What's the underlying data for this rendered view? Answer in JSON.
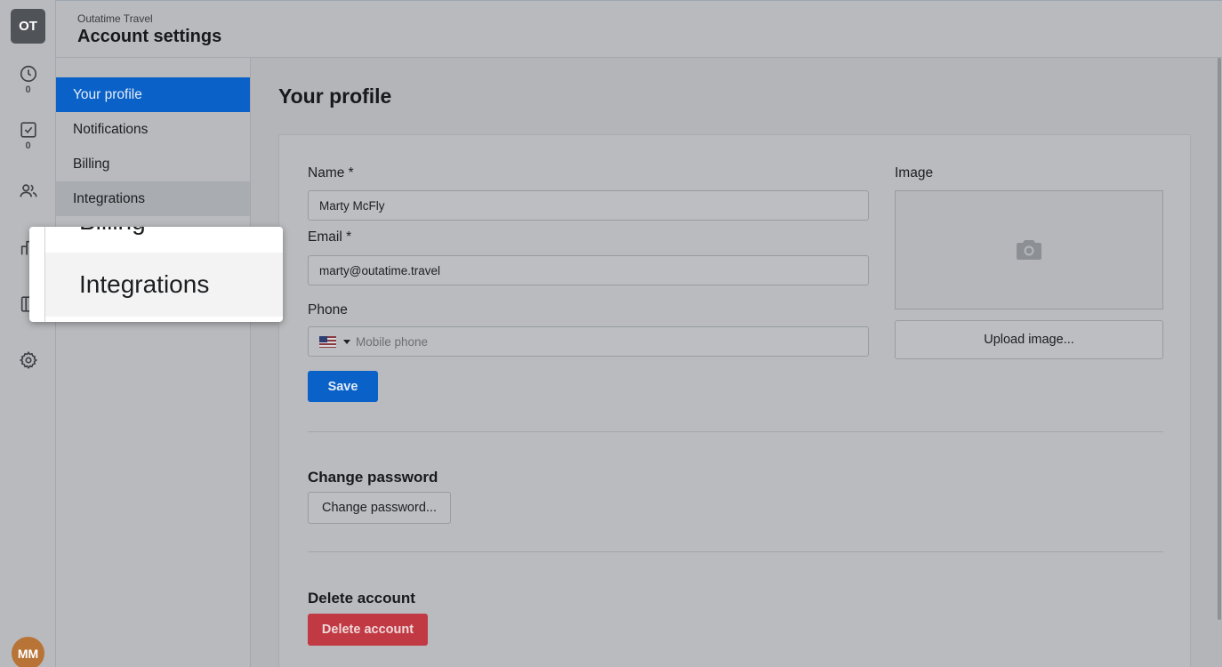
{
  "rail": {
    "org_initials": "OT",
    "items": [
      {
        "icon": "clock-icon",
        "count": "0"
      },
      {
        "icon": "checkbox-icon",
        "count": "0"
      },
      {
        "icon": "users-icon"
      },
      {
        "icon": "building-icon"
      },
      {
        "icon": "book-icon"
      },
      {
        "icon": "gear-icon"
      }
    ],
    "user_initials": "MM"
  },
  "header": {
    "org_name": "Outatime Travel",
    "title": "Account settings"
  },
  "settings_nav": {
    "items": [
      {
        "label": "Your profile",
        "state": "active"
      },
      {
        "label": "Notifications"
      },
      {
        "label": "Billing"
      },
      {
        "label": "Integrations",
        "state": "hover"
      }
    ]
  },
  "main": {
    "title": "Your profile",
    "form": {
      "name_label": "Name *",
      "name_value": "Marty McFly",
      "email_label": "Email *",
      "email_value": "marty@outatime.travel",
      "phone_label": "Phone",
      "phone_placeholder": "Mobile phone",
      "phone_country": "flag-us-icon",
      "save_label": "Save",
      "image_label": "Image",
      "upload_label": "Upload image..."
    },
    "password": {
      "title": "Change password",
      "button_label": "Change password..."
    },
    "delete": {
      "title": "Delete account",
      "button_label": "Delete account"
    }
  },
  "zoom": {
    "prev_label": "Billing",
    "label": "Integrations"
  },
  "colors": {
    "accent": "#0a61c8",
    "danger": "#c13a43",
    "avatar": "#b87437",
    "org_badge": "#505357"
  }
}
